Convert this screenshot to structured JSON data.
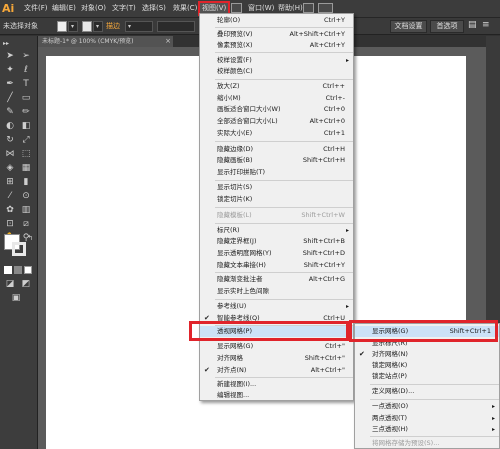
{
  "app_logo": "Ai",
  "menubar": {
    "items": [
      "文件(F)",
      "编辑(E)",
      "对象(O)",
      "文字(T)",
      "选择(S)",
      "效果(C)",
      "视图(V)",
      "窗口(W)",
      "帮助(H)"
    ]
  },
  "control_bar": {
    "selection_status": "未选择对象",
    "stroke_label": "描边",
    "doc_setup": "文档设置",
    "preferences": "首选项"
  },
  "doc_tab": {
    "title": "未标题-1* @ 100% (CMYK/预览)",
    "close": "×"
  },
  "view_menu": {
    "items": [
      {
        "label": "轮廓(O)",
        "shortcut": "Ctrl+Y"
      },
      {
        "label": "叠印预览(V)",
        "shortcut": "Alt+Shift+Ctrl+Y"
      },
      {
        "label": "像素预览(X)",
        "shortcut": "Alt+Ctrl+Y"
      },
      {
        "label": "校样设置(F)",
        "arrow": "▸"
      },
      {
        "label": "校样颜色(C)"
      },
      {
        "label": "放大(Z)",
        "shortcut": "Ctrl++"
      },
      {
        "label": "缩小(M)",
        "shortcut": "Ctrl+-"
      },
      {
        "label": "画板适合窗口大小(W)",
        "shortcut": "Ctrl+0"
      },
      {
        "label": "全部适合窗口大小(L)",
        "shortcut": "Alt+Ctrl+0"
      },
      {
        "label": "实际大小(E)",
        "shortcut": "Ctrl+1"
      },
      {
        "label": "隐藏边缘(D)",
        "shortcut": "Ctrl+H"
      },
      {
        "label": "隐藏画板(B)",
        "shortcut": "Shift+Ctrl+H"
      },
      {
        "label": "显示打印拼贴(T)"
      },
      {
        "label": "显示切片(S)"
      },
      {
        "label": "锁定切片(K)"
      },
      {
        "label": "隐藏模板(L)",
        "shortcut": "Shift+Ctrl+W",
        "disabled": true
      },
      {
        "label": "标尺(R)",
        "arrow": "▸"
      },
      {
        "label": "隐藏定界框(J)",
        "shortcut": "Shift+Ctrl+B"
      },
      {
        "label": "显示透明度网格(Y)",
        "shortcut": "Shift+Ctrl+D"
      },
      {
        "label": "隐藏文本串接(H)",
        "shortcut": "Shift+Ctrl+Y"
      },
      {
        "label": "隐藏渐变批注者",
        "shortcut": "Alt+Ctrl+G"
      },
      {
        "label": "显示实时上色间隙"
      },
      {
        "label": "参考线(U)",
        "arrow": "▸"
      },
      {
        "label": "智能参考线(Q)",
        "shortcut": "Ctrl+U",
        "checked": true
      },
      {
        "label": "透视网格(P)",
        "arrow": "▸"
      },
      {
        "label": "显示网格(G)",
        "shortcut": "Ctrl+\""
      },
      {
        "label": "对齐网格",
        "shortcut": "Shift+Ctrl+\""
      },
      {
        "label": "对齐点(N)",
        "shortcut": "Alt+Ctrl+\""
      },
      {
        "label": "新建视图(I)..."
      },
      {
        "label": "编辑视图..."
      }
    ]
  },
  "persp_submenu": {
    "items": [
      {
        "label": "显示网格(G)",
        "shortcut": "Shift+Ctrl+1"
      },
      {
        "label": "显示标尺(R)"
      },
      {
        "label": "对齐网格(N)",
        "checked": true
      },
      {
        "label": "锁定网格(K)"
      },
      {
        "label": "锁定站点(P)"
      },
      {
        "label": "定义网格(D)..."
      },
      {
        "label": "一点透视(O)",
        "arrow": "▸"
      },
      {
        "label": "两点透视(T)",
        "arrow": "▸"
      },
      {
        "label": "三点透视(H)",
        "arrow": "▸"
      },
      {
        "label": "将网格存储为预设(S)...",
        "disabled": true
      }
    ]
  },
  "colors": {
    "highlight_red": "#e0242b",
    "menu_hover": "#cce2f7",
    "logo_orange": "#f7a83a"
  }
}
